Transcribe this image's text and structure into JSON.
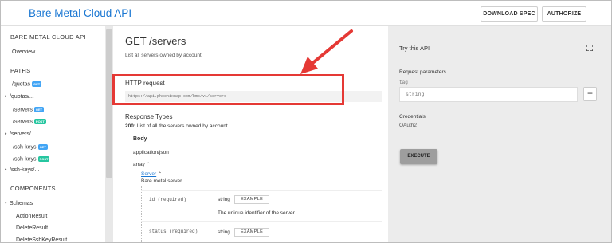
{
  "header": {
    "app_title": "Bare Metal Cloud API",
    "download_spec": "DOWNLOAD SPEC",
    "authorize": "AUTHORIZE"
  },
  "sidebar": {
    "api_title": "BARE METAL CLOUD API",
    "overview": "Overview",
    "paths_heading": "PATHS",
    "paths": [
      {
        "label": "/quotas",
        "badge": "GET",
        "caret": false
      },
      {
        "label": "/quotas/...",
        "badge": "",
        "caret": true
      },
      {
        "label": "/servers",
        "badge": "GET",
        "caret": false
      },
      {
        "label": "/servers",
        "badge": "POST",
        "caret": false
      },
      {
        "label": "/servers/...",
        "badge": "",
        "caret": true
      },
      {
        "label": "/ssh-keys",
        "badge": "GET",
        "caret": false
      },
      {
        "label": "/ssh-keys",
        "badge": "POST",
        "caret": false
      },
      {
        "label": "/ssh-keys/...",
        "badge": "",
        "caret": true
      }
    ],
    "components_heading": "COMPONENTS",
    "schemas_label": "Schemas",
    "schemas": [
      "ActionResult",
      "DeleteResult",
      "DeleteSshKeyResult"
    ]
  },
  "main": {
    "title": "GET /servers",
    "description": "List all servers owned by account.",
    "http_request_title": "HTTP request",
    "http_request_url": "https://api.phoenixnap.com/bmc/v1/servers",
    "response_types_title": "Response Types",
    "response_code": "200:",
    "response_desc": "List of all the servers owned by account.",
    "body_label": "Body",
    "content_type": "application/json",
    "array_label": "array",
    "server_link": "Server",
    "server_desc": "Bare metal server.",
    "fields": [
      {
        "name": "id (required)",
        "type": "string",
        "example": "EXAMPLE",
        "description": "The unique identifier of the server."
      },
      {
        "name": "status (required)",
        "type": "string",
        "example": "EXAMPLE",
        "description": ""
      }
    ]
  },
  "try_panel": {
    "title": "Try this API",
    "request_params_label": "Request parameters",
    "tag_label": "tag",
    "tag_placeholder": "string",
    "credentials_label": "Credentials",
    "credentials_value": "OAuth2",
    "execute_label": "EXECUTE"
  },
  "annotation": {
    "color": "#e53935"
  }
}
